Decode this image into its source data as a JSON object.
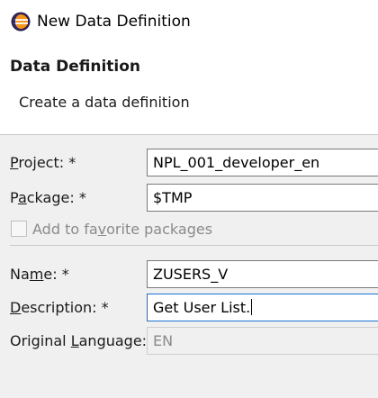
{
  "window": {
    "title": "New Data Definition",
    "icon": "eclipse-icon"
  },
  "header": {
    "title": "Data Definition",
    "message": "Create a data definition"
  },
  "form": {
    "project": {
      "label_pre": "",
      "label_mn": "P",
      "label_post": "roject: *",
      "value": "NPL_001_developer_en"
    },
    "package": {
      "label_pre": "P",
      "label_mn": "a",
      "label_post": "ckage: *",
      "value": "$TMP"
    },
    "favorite": {
      "label_pre": "Add to fa",
      "label_mn": "v",
      "label_post": "orite packages",
      "checked": false
    },
    "name": {
      "label_pre": "Na",
      "label_mn": "m",
      "label_post": "e: *",
      "value": "ZUSERS_V"
    },
    "description": {
      "label_pre": "",
      "label_mn": "D",
      "label_post": "escription: *",
      "value": "Get User List."
    },
    "language": {
      "label_pre": "Original ",
      "label_mn": "L",
      "label_post": "anguage:",
      "value": "EN"
    }
  },
  "colors": {
    "focus_border": "#1a73d0",
    "disabled_text": "#8a8a8a"
  }
}
